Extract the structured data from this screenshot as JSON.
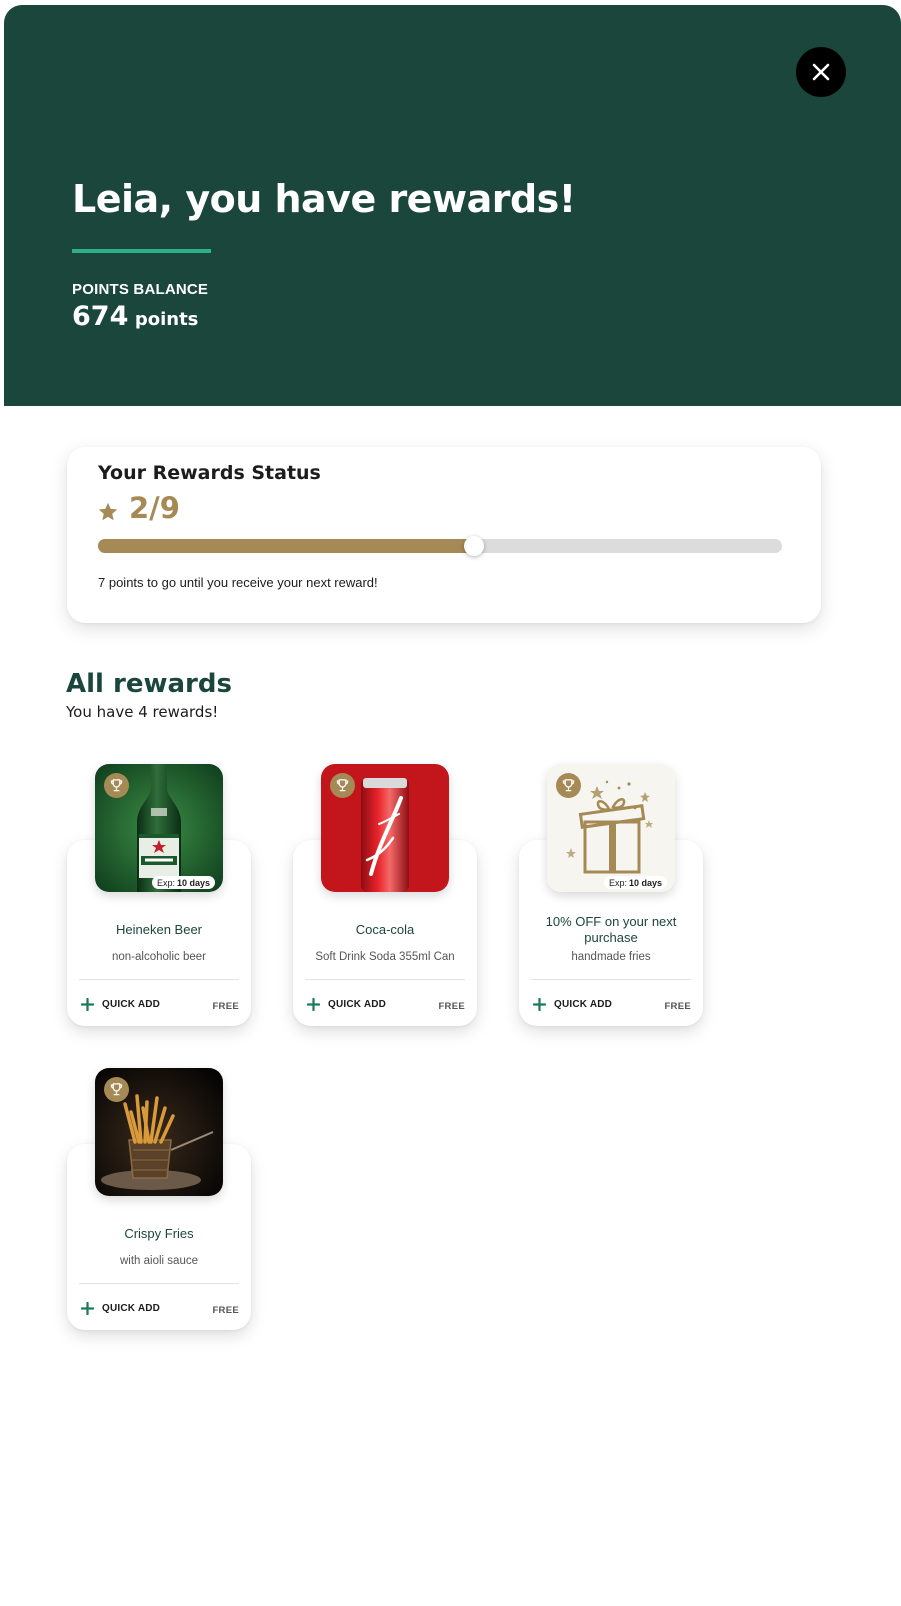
{
  "hero": {
    "title": "Leia, you have rewards!",
    "points_label": "POINTS BALANCE",
    "points_value": "674",
    "points_unit": "points",
    "background_color": "#1b463c",
    "accent_color": "#2fb08a"
  },
  "close": {
    "icon": "close-icon"
  },
  "status": {
    "title": "Your Rewards Status",
    "level": "2/9",
    "progress": 0.55,
    "note": "7 points to go until you receive your next reward!",
    "accent_color": "#a68a55"
  },
  "rewards_section": {
    "title": "All rewards",
    "subtitle": "You have 4 rewards!"
  },
  "rewards": [
    {
      "name": "Heineken Beer",
      "description": "non-alcoholic beer",
      "exp_label": "Exp:",
      "exp_value": "10 days",
      "action": "QUICK ADD",
      "price": "FREE",
      "image": "heineken-bottle"
    },
    {
      "name": "Coca-cola",
      "description": "Soft Drink Soda 355ml Can",
      "action": "QUICK ADD",
      "price": "FREE",
      "image": "coca-cola-can"
    },
    {
      "name": "10% OFF on your next purchase",
      "description": "handmade fries",
      "exp_label": "Exp:",
      "exp_value": "10 days",
      "action": "QUICK ADD",
      "price": "FREE",
      "image": "gift-box"
    },
    {
      "name": "Crispy Fries",
      "description": "with aioli sauce",
      "action": "QUICK ADD",
      "price": "FREE",
      "image": "fries-basket"
    }
  ]
}
